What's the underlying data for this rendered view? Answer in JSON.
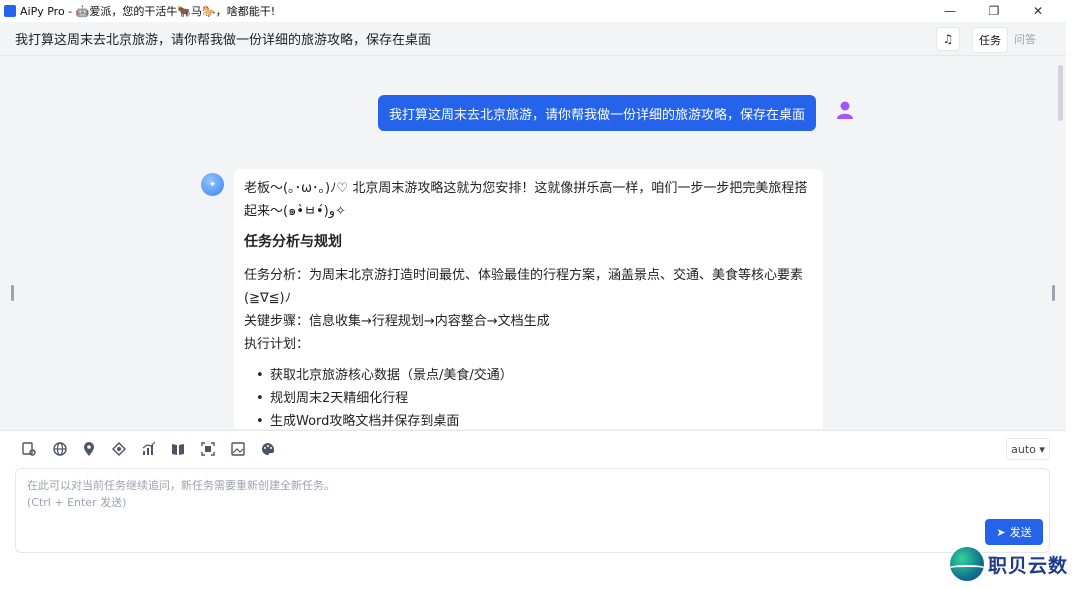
{
  "window": {
    "title": "AiPy Pro - 🤖爱派，您的干活牛🐂马🐎，啥都能干!",
    "minimize": "—",
    "maximize": "❐",
    "close": "✕"
  },
  "header": {
    "task_title": "我打算这周末去北京旅游，请你帮我做一份详细的旅游攻略，保存在桌面",
    "mode_task": "任务",
    "mode_qa": "问答",
    "icon": "music-note-icon"
  },
  "chat": {
    "user_message": "我打算这周末去北京旅游，请你帮我做一份详细的旅游攻略，保存在桌面",
    "bot": {
      "intro": "老板～(｡･ω･｡)ﾉ♡ 北京周末游攻略这就为您安排！这就像拼乐高一样，咱们一步一步把完美旅程搭起来～(๑•̀ㅂ•́)و✧",
      "section_title": "任务分析与规划",
      "lines": [
        "任务分析：为周末北京游打造时间最优、体验最佳的行程方案，涵盖景点、交通、美食等核心要素(≧∇≦)ﾉ",
        "关键步骤：信息收集→行程规划→内容整合→文档生成",
        "执行计划："
      ],
      "bullets": [
        "获取北京旅游核心数据（景点/美食/交通）",
        "规划周末2天精细化行程",
        "生成Word攻略文档并保存到桌面"
      ]
    }
  },
  "toolbar": {
    "tools": [
      "task-icon",
      "globe-icon",
      "location-icon",
      "brain-icon",
      "chart-icon",
      "book-icon",
      "screenshot-icon",
      "image-icon",
      "palette-icon"
    ],
    "model": "auto ▾"
  },
  "input": {
    "placeholder": "在此可以对当前任务继续追问，新任务需要重新创建全新任务。\n(Ctrl + Enter 发送)",
    "send_label": "发送"
  },
  "watermark": {
    "text": "职贝云数"
  },
  "colors": {
    "accent": "#2563eb",
    "background": "#f3f4f6"
  }
}
